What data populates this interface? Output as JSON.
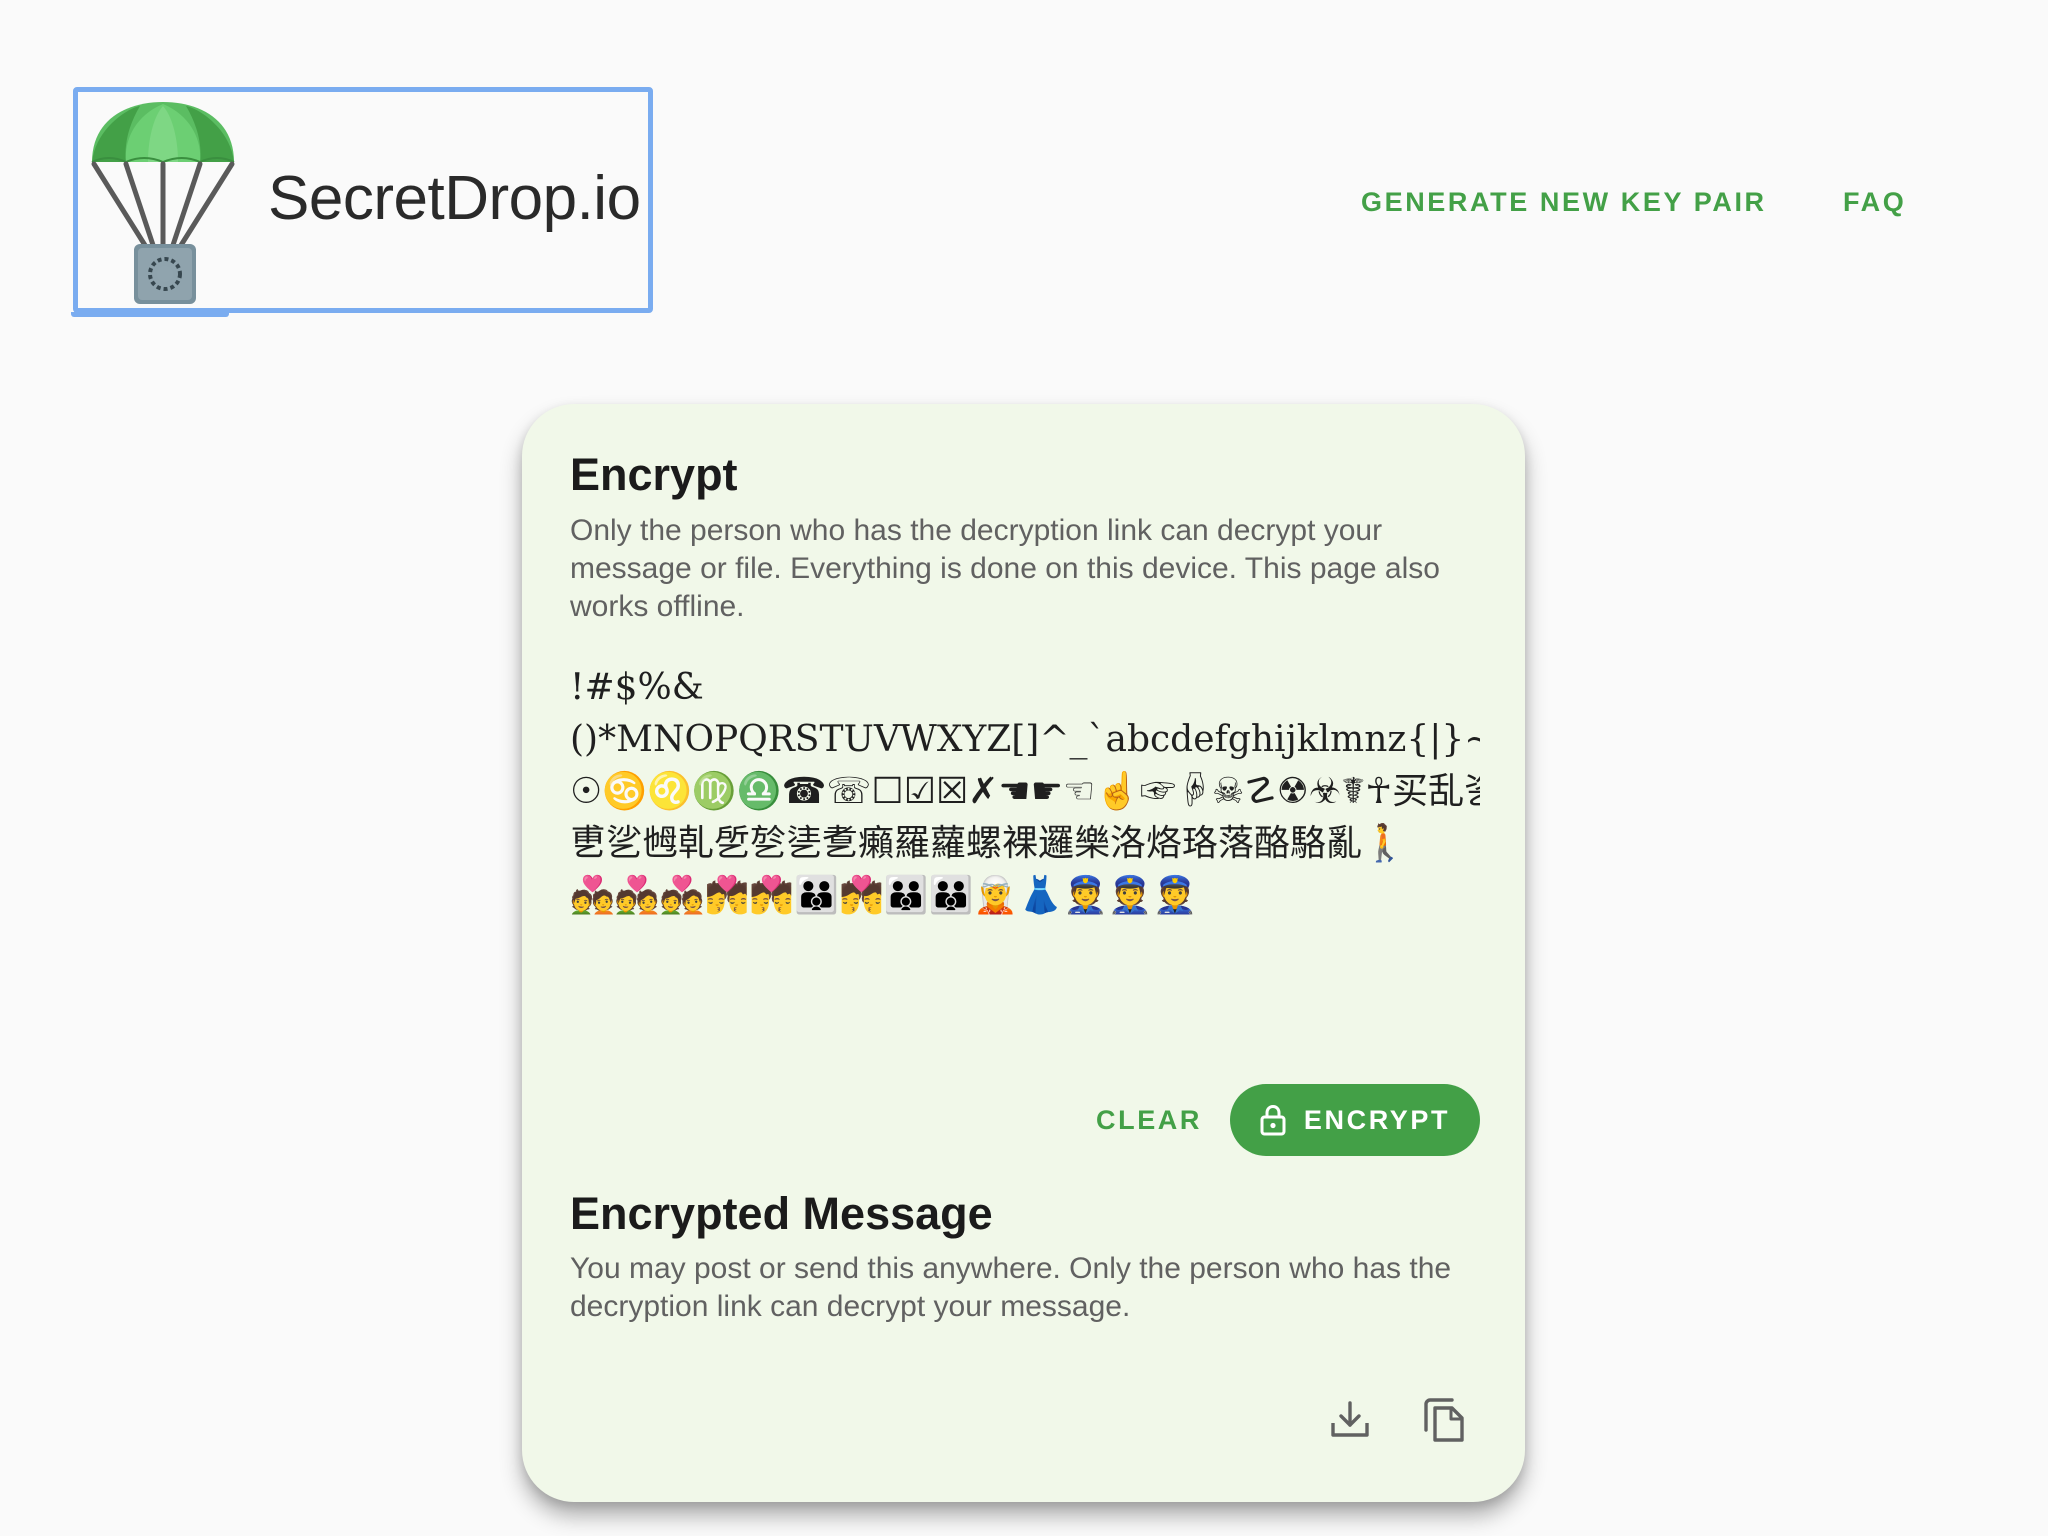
{
  "header": {
    "brand": "SecretDrop.io",
    "nav": [
      {
        "label": "GENERATE NEW KEY PAIR"
      },
      {
        "label": "FAQ"
      }
    ]
  },
  "encrypt": {
    "title": "Encrypt",
    "description": "Only the person who has the decryption link can decrypt your message or file. Everything is done on this device. This page also works offline.",
    "message_lines": [
      "!#$%&",
      "()*MNOPQRSTUVWXYZ[]^_`abcdefghijklmnz{|}~⪡⪢",
      "☉♋♌♍♎☎☏☐☑☒✗☚☛☜☝☞☟☠☡☢☣☤☥买乱乲乳乴乵",
      "乶乷乸乹乺乻乼乽癩羅蘿螺裸邏樂洛烙珞落酪駱亂🚶",
      "💑💑💑💏💏👪💏👪👪🧝👗👮👮👮"
    ],
    "clear_label": "CLEAR",
    "encrypt_label": "ENCRYPT"
  },
  "output": {
    "title": "Encrypted Message",
    "description": "You may post or send this anywhere. Only the person who has the decryption link can decrypt your message."
  },
  "icons": {
    "logo": "parachute-safe-icon",
    "lock": "lock-icon",
    "download": "download-icon",
    "copy": "copy-icon"
  },
  "colors": {
    "accent": "#43a047",
    "card_background": "#f1f8e9",
    "page_background": "#fafafa",
    "focus_outline": "#7aacf0"
  }
}
